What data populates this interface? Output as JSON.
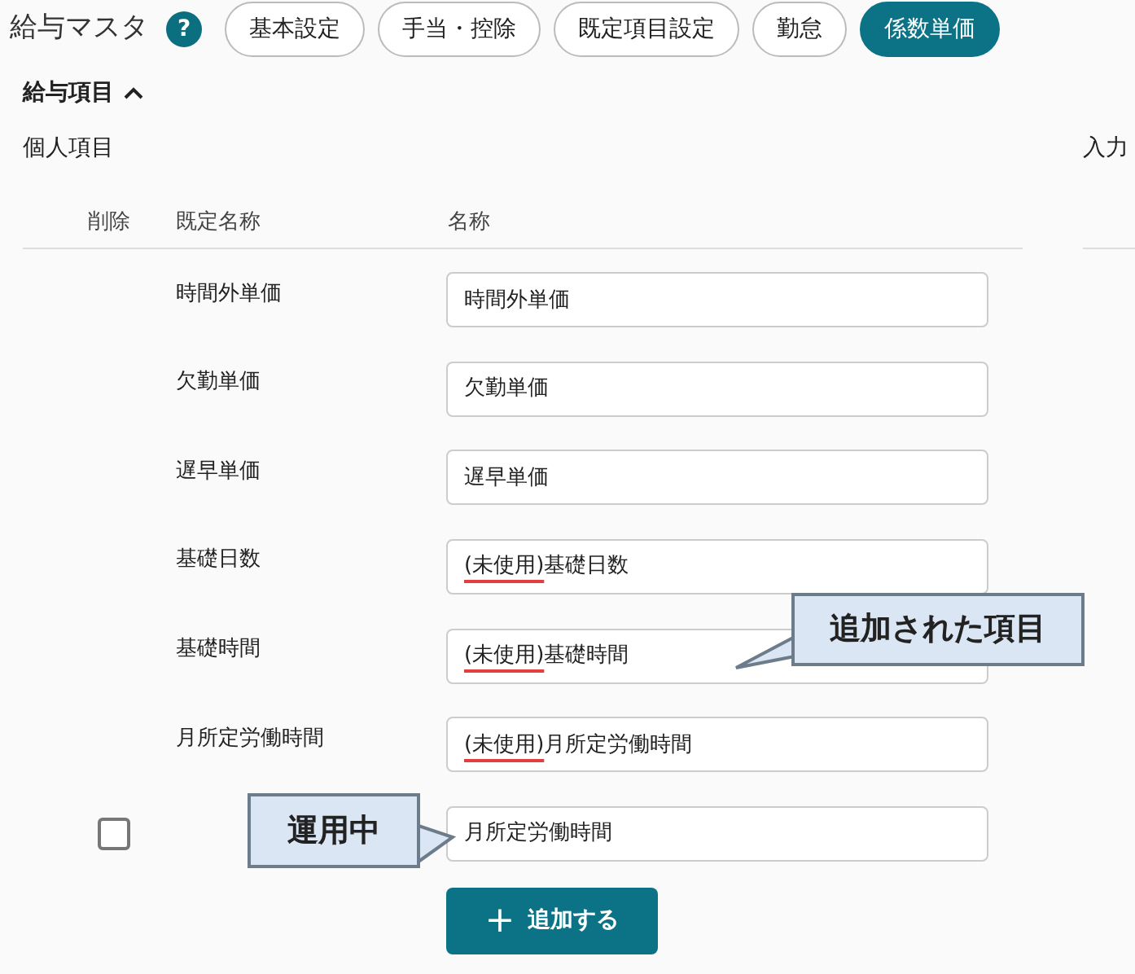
{
  "header": {
    "title": "給与マスタ",
    "help_icon": "?",
    "tabs": [
      {
        "label": "基本設定",
        "selected": false
      },
      {
        "label": "手当・控除",
        "selected": false
      },
      {
        "label": "既定項目設定",
        "selected": false
      },
      {
        "label": "勤怠",
        "selected": false
      },
      {
        "label": "係数単価",
        "selected": true
      }
    ]
  },
  "section": {
    "title": "給与項目",
    "expanded": true
  },
  "subsection": "個人項目",
  "right_heading": "入力",
  "table": {
    "columns": [
      "削除",
      "既定名称",
      "名称"
    ],
    "rows": [
      {
        "kind": "default",
        "default_name": "時間外単価",
        "value_parts": [
          {
            "text": "時間外単価",
            "underlined": false
          }
        ]
      },
      {
        "kind": "default",
        "default_name": "欠勤単価",
        "value_parts": [
          {
            "text": "欠勤単価",
            "underlined": false
          }
        ]
      },
      {
        "kind": "default",
        "default_name": "遅早単価",
        "value_parts": [
          {
            "text": "遅早単価",
            "underlined": false
          }
        ]
      },
      {
        "kind": "default",
        "default_name": "基礎日数",
        "value_parts": [
          {
            "text": "(未使用)",
            "underlined": true
          },
          {
            "text": "基礎日数",
            "underlined": false
          }
        ]
      },
      {
        "kind": "default",
        "default_name": "基礎時間",
        "value_parts": [
          {
            "text": "(未使用)",
            "underlined": true
          },
          {
            "text": "基礎時間",
            "underlined": false
          }
        ]
      },
      {
        "kind": "default",
        "default_name": "月所定労働時間",
        "value_parts": [
          {
            "text": "(未使用)",
            "underlined": true
          },
          {
            "text": "月所定労働時間",
            "underlined": false
          }
        ]
      },
      {
        "kind": "custom",
        "checked": false,
        "value_parts": [
          {
            "text": "月所定労働時間",
            "underlined": false
          }
        ]
      }
    ]
  },
  "add_button": {
    "icon": "+",
    "label": "追加する"
  },
  "callouts": [
    {
      "text": "追加された項目"
    },
    {
      "text": "運用中"
    }
  ]
}
